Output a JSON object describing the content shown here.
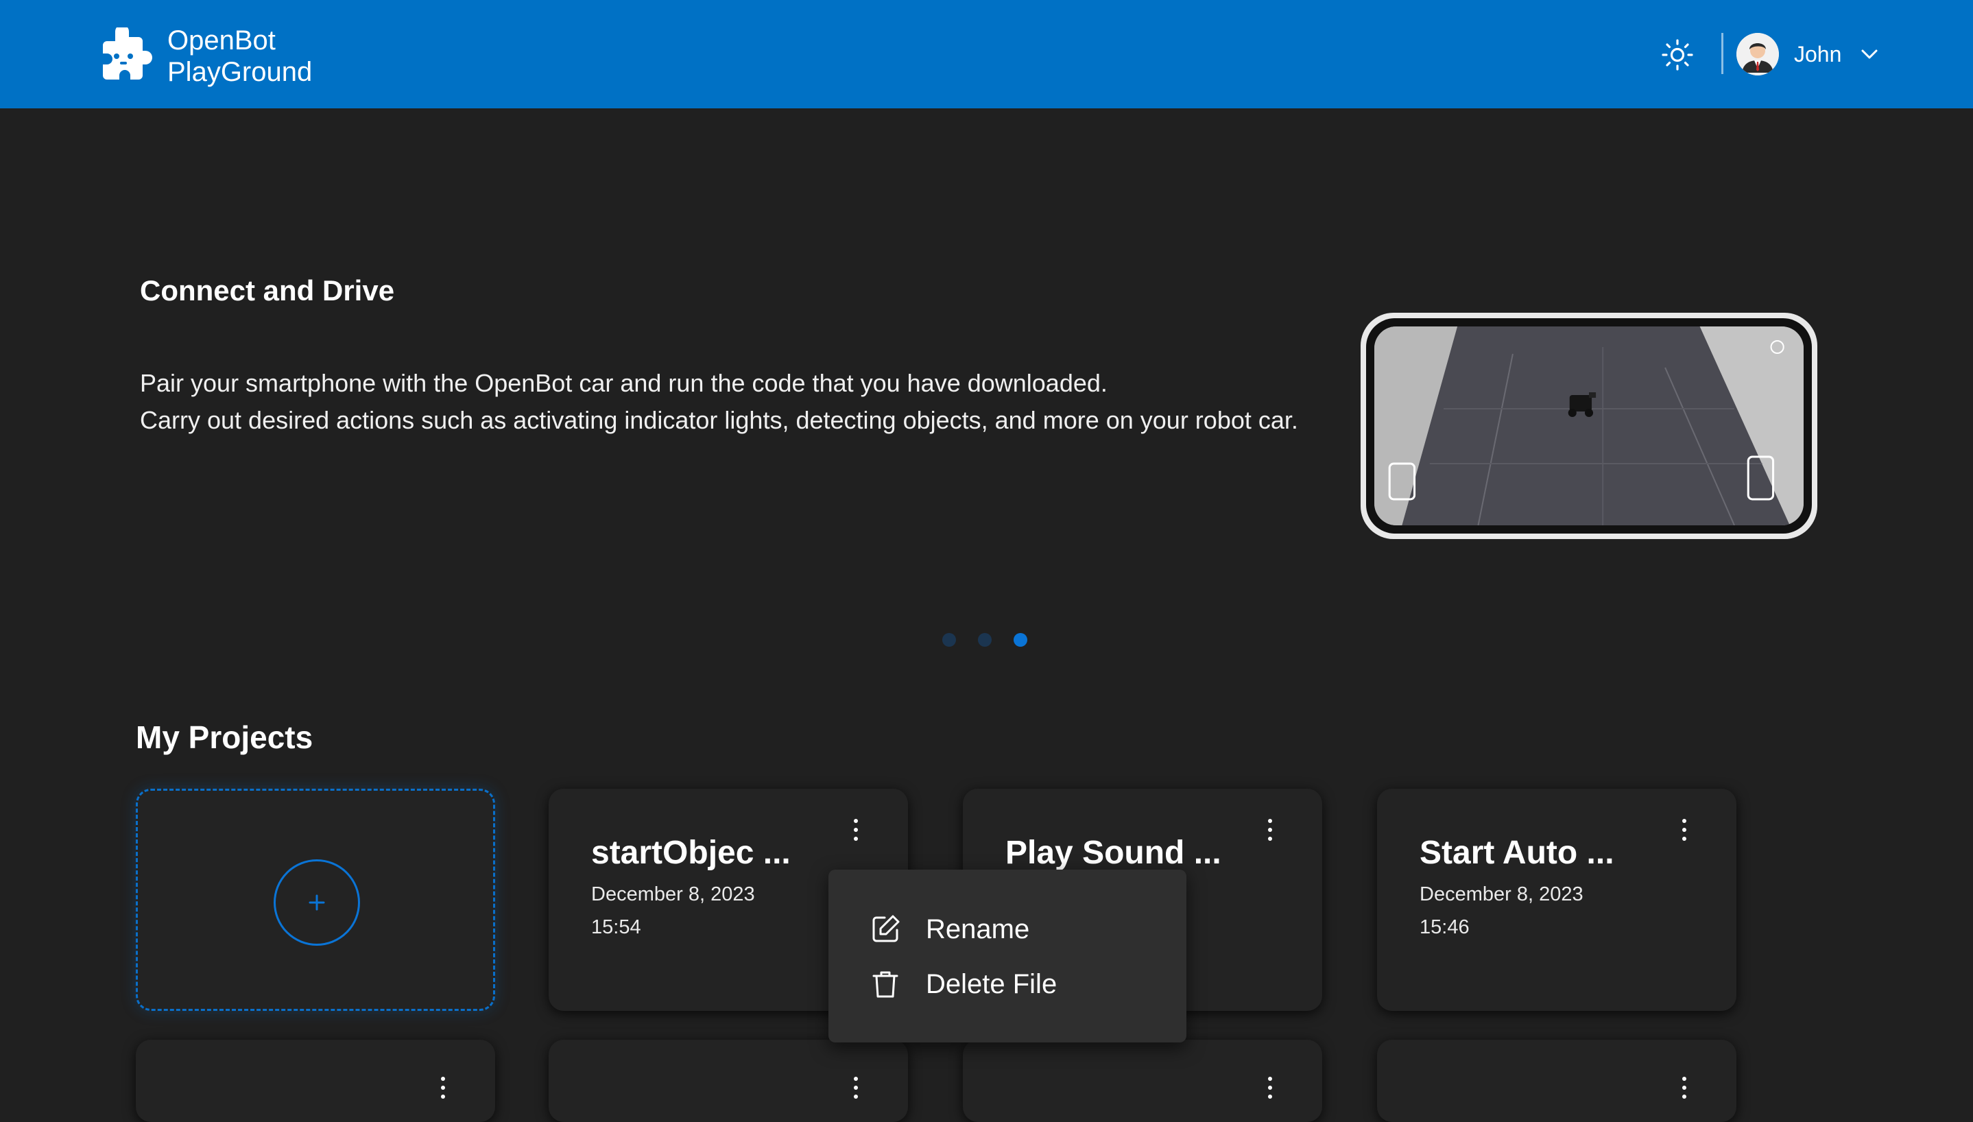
{
  "app": {
    "logo_line1": "OpenBot",
    "logo_line2": "PlayGround",
    "brand_color": "#0071c5",
    "background_color": "#202020"
  },
  "header": {
    "theme_icon": "sun-icon",
    "user_name": "John"
  },
  "hero": {
    "title": "Connect and Drive",
    "line1": "Pair your smartphone with the OpenBot car and run the code that you have downloaded.",
    "line2": "Carry out desired actions such as activating indicator lights, detecting objects, and more on your robot car.",
    "carousel_total": 3,
    "carousel_active_index": 3
  },
  "projects": {
    "title": "My Projects",
    "new_icon": "plus-icon",
    "items": [
      {
        "title": "startObjec ...",
        "date": "December 8, 2023",
        "time": "15:54"
      },
      {
        "title": "Play Sound ...",
        "date": "",
        "time": ""
      },
      {
        "title": "Start Auto ...",
        "date": "December 8, 2023",
        "time": "15:46"
      }
    ]
  },
  "context_menu": {
    "rename_label": "Rename",
    "delete_label": "Delete File"
  }
}
